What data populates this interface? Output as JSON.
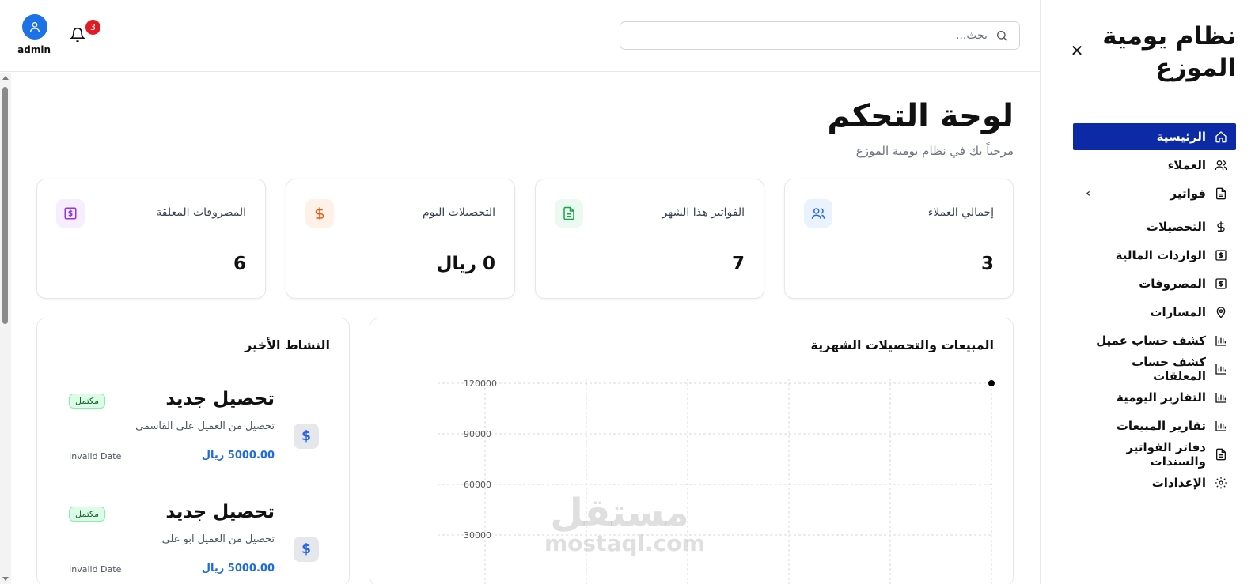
{
  "sidebar": {
    "app_title": "نظام يومية الموزع",
    "close_label": "✕",
    "items": [
      {
        "label": "الرئيسية",
        "icon": "home-icon"
      },
      {
        "label": "العملاء",
        "icon": "users-icon"
      },
      {
        "label": "فواتير",
        "icon": "file-icon",
        "chevron": "›"
      },
      {
        "label": "التحصيلات",
        "icon": "dollar-icon"
      },
      {
        "label": "الواردات المالية",
        "icon": "money-icon"
      },
      {
        "label": "المصروفات",
        "icon": "money-icon"
      },
      {
        "label": "المسارات",
        "icon": "map-pin-icon"
      },
      {
        "label": "كشف حساب عميل",
        "icon": "bar-chart-icon"
      },
      {
        "label": "كشف حساب المعلقات",
        "icon": "bar-chart-icon"
      },
      {
        "label": "التقارير اليومية",
        "icon": "bar-chart-icon"
      },
      {
        "label": "تقارير المبيعات",
        "icon": "bar-chart-icon"
      },
      {
        "label": "دفاتر الفواتير والسندات",
        "icon": "file-icon"
      },
      {
        "label": "الإعدادات",
        "icon": "gear-icon"
      }
    ],
    "active_color": "#0c2aa6"
  },
  "header": {
    "search_placeholder": "بحث...",
    "user_name": "admin",
    "notification_count": "3"
  },
  "main": {
    "title": "لوحة التحكم",
    "subtitle": "مرحباً بك في نظام يومية الموزع"
  },
  "stats": [
    {
      "label": "إجمالي العملاء",
      "value": "3",
      "icon": "users-icon",
      "color": "#2563eb"
    },
    {
      "label": "الفواتير هذا الشهر",
      "value": "7",
      "icon": "file-text-icon",
      "color": "#16a34a"
    },
    {
      "label": "التحصيلات اليوم",
      "value": "0 ريال",
      "icon": "dollar-icon",
      "color": "#ea580c"
    },
    {
      "label": "المصروفات المعلقة",
      "value": "6",
      "icon": "money-icon",
      "color": "#9333ea"
    }
  ],
  "chart": {
    "title": "المبيعات والتحصيلات الشهرية"
  },
  "chart_data": {
    "type": "line",
    "title": "المبيعات والتحصيلات الشهرية",
    "yticks": [
      120000,
      90000,
      60000,
      30000
    ],
    "ylim": [
      0,
      120000
    ],
    "grid": true,
    "points": [
      {
        "y": 120000
      }
    ]
  },
  "activity": {
    "title": "النشاط الأخير",
    "items": [
      {
        "title": "تحصيل جديد",
        "description": "تحصيل من العميل علي القاسمي",
        "amount": "5000.00 ريال",
        "date": "Invalid Date",
        "status": "مكتمل",
        "icon": "$"
      },
      {
        "title": "تحصيل جديد",
        "description": "تحصيل من العميل ابو علي",
        "amount": "5000.00 ريال",
        "date": "Invalid Date",
        "status": "مكتمل",
        "icon": "$"
      }
    ]
  },
  "watermark": {
    "arabic": "مستقل",
    "latin": "mostaql.com"
  }
}
